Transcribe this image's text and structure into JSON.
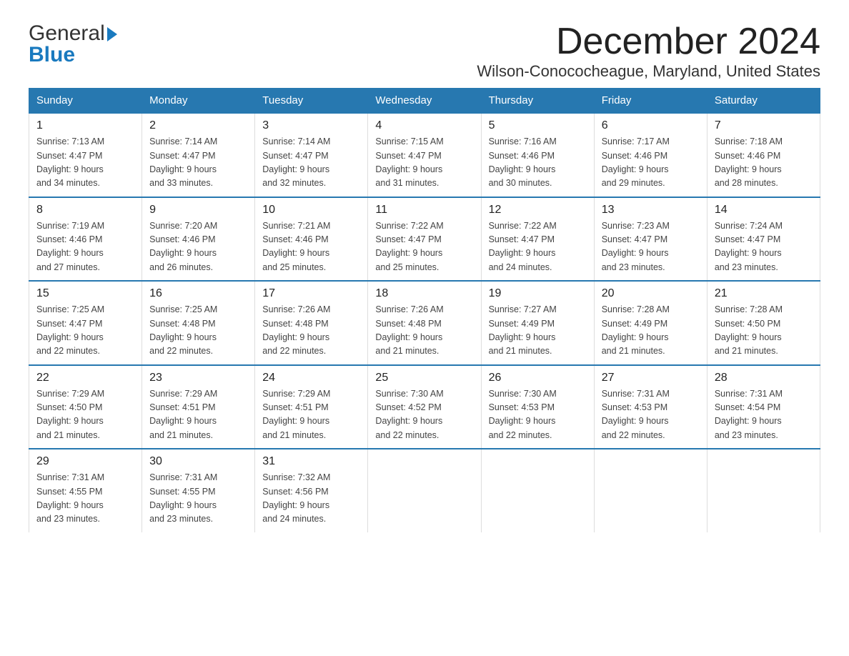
{
  "header": {
    "logo_general": "General",
    "logo_blue": "Blue",
    "month_title": "December 2024",
    "location": "Wilson-Conococheague, Maryland, United States"
  },
  "days_of_week": [
    "Sunday",
    "Monday",
    "Tuesday",
    "Wednesday",
    "Thursday",
    "Friday",
    "Saturday"
  ],
  "weeks": [
    [
      {
        "day": "1",
        "sunrise": "7:13 AM",
        "sunset": "4:47 PM",
        "daylight": "9 hours and 34 minutes."
      },
      {
        "day": "2",
        "sunrise": "7:14 AM",
        "sunset": "4:47 PM",
        "daylight": "9 hours and 33 minutes."
      },
      {
        "day": "3",
        "sunrise": "7:14 AM",
        "sunset": "4:47 PM",
        "daylight": "9 hours and 32 minutes."
      },
      {
        "day": "4",
        "sunrise": "7:15 AM",
        "sunset": "4:47 PM",
        "daylight": "9 hours and 31 minutes."
      },
      {
        "day": "5",
        "sunrise": "7:16 AM",
        "sunset": "4:46 PM",
        "daylight": "9 hours and 30 minutes."
      },
      {
        "day": "6",
        "sunrise": "7:17 AM",
        "sunset": "4:46 PM",
        "daylight": "9 hours and 29 minutes."
      },
      {
        "day": "7",
        "sunrise": "7:18 AM",
        "sunset": "4:46 PM",
        "daylight": "9 hours and 28 minutes."
      }
    ],
    [
      {
        "day": "8",
        "sunrise": "7:19 AM",
        "sunset": "4:46 PM",
        "daylight": "9 hours and 27 minutes."
      },
      {
        "day": "9",
        "sunrise": "7:20 AM",
        "sunset": "4:46 PM",
        "daylight": "9 hours and 26 minutes."
      },
      {
        "day": "10",
        "sunrise": "7:21 AM",
        "sunset": "4:46 PM",
        "daylight": "9 hours and 25 minutes."
      },
      {
        "day": "11",
        "sunrise": "7:22 AM",
        "sunset": "4:47 PM",
        "daylight": "9 hours and 25 minutes."
      },
      {
        "day": "12",
        "sunrise": "7:22 AM",
        "sunset": "4:47 PM",
        "daylight": "9 hours and 24 minutes."
      },
      {
        "day": "13",
        "sunrise": "7:23 AM",
        "sunset": "4:47 PM",
        "daylight": "9 hours and 23 minutes."
      },
      {
        "day": "14",
        "sunrise": "7:24 AM",
        "sunset": "4:47 PM",
        "daylight": "9 hours and 23 minutes."
      }
    ],
    [
      {
        "day": "15",
        "sunrise": "7:25 AM",
        "sunset": "4:47 PM",
        "daylight": "9 hours and 22 minutes."
      },
      {
        "day": "16",
        "sunrise": "7:25 AM",
        "sunset": "4:48 PM",
        "daylight": "9 hours and 22 minutes."
      },
      {
        "day": "17",
        "sunrise": "7:26 AM",
        "sunset": "4:48 PM",
        "daylight": "9 hours and 22 minutes."
      },
      {
        "day": "18",
        "sunrise": "7:26 AM",
        "sunset": "4:48 PM",
        "daylight": "9 hours and 21 minutes."
      },
      {
        "day": "19",
        "sunrise": "7:27 AM",
        "sunset": "4:49 PM",
        "daylight": "9 hours and 21 minutes."
      },
      {
        "day": "20",
        "sunrise": "7:28 AM",
        "sunset": "4:49 PM",
        "daylight": "9 hours and 21 minutes."
      },
      {
        "day": "21",
        "sunrise": "7:28 AM",
        "sunset": "4:50 PM",
        "daylight": "9 hours and 21 minutes."
      }
    ],
    [
      {
        "day": "22",
        "sunrise": "7:29 AM",
        "sunset": "4:50 PM",
        "daylight": "9 hours and 21 minutes."
      },
      {
        "day": "23",
        "sunrise": "7:29 AM",
        "sunset": "4:51 PM",
        "daylight": "9 hours and 21 minutes."
      },
      {
        "day": "24",
        "sunrise": "7:29 AM",
        "sunset": "4:51 PM",
        "daylight": "9 hours and 21 minutes."
      },
      {
        "day": "25",
        "sunrise": "7:30 AM",
        "sunset": "4:52 PM",
        "daylight": "9 hours and 22 minutes."
      },
      {
        "day": "26",
        "sunrise": "7:30 AM",
        "sunset": "4:53 PM",
        "daylight": "9 hours and 22 minutes."
      },
      {
        "day": "27",
        "sunrise": "7:31 AM",
        "sunset": "4:53 PM",
        "daylight": "9 hours and 22 minutes."
      },
      {
        "day": "28",
        "sunrise": "7:31 AM",
        "sunset": "4:54 PM",
        "daylight": "9 hours and 23 minutes."
      }
    ],
    [
      {
        "day": "29",
        "sunrise": "7:31 AM",
        "sunset": "4:55 PM",
        "daylight": "9 hours and 23 minutes."
      },
      {
        "day": "30",
        "sunrise": "7:31 AM",
        "sunset": "4:55 PM",
        "daylight": "9 hours and 23 minutes."
      },
      {
        "day": "31",
        "sunrise": "7:32 AM",
        "sunset": "4:56 PM",
        "daylight": "9 hours and 24 minutes."
      },
      null,
      null,
      null,
      null
    ]
  ],
  "labels": {
    "sunrise": "Sunrise:",
    "sunset": "Sunset:",
    "daylight": "Daylight: 9 hours"
  }
}
